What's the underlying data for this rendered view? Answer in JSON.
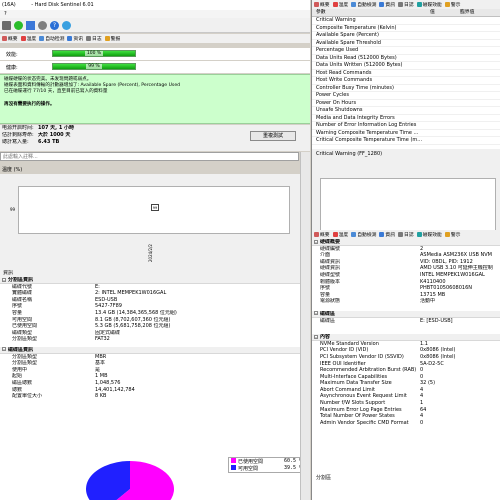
{
  "window": {
    "title_prefix": "(16A)",
    "title": "- Hard Disk Sentinel 6.01"
  },
  "menu": [
    "?"
  ],
  "toolbar_left": {
    "items": [
      "概要",
      "温度",
      "自动检测",
      "资讯",
      "日志",
      "警报"
    ]
  },
  "bars": [
    {
      "label": "效能:",
      "text": "100 %",
      "value": 100,
      "color": "#18c028"
    },
    {
      "label": "健康:",
      "text": "99 %",
      "value": 99,
      "color": "#18c028"
    }
  ],
  "status_box": {
    "lines": [
      "磁碟硬碟的状态完美。未发现問題或弱点。",
      "磁碟表面和資料傳輸的計數器增加了: Available Spare (Percent), Percentage Used",
      "已在磁碟運行 77/10 天，直至目前已寫入的資料量",
      "",
      "再沒有需要执行的操作。"
    ],
    "action_title": "再沒有需要执行的操作。"
  },
  "power": {
    "rows": [
      {
        "k": "电源开启时间:",
        "v": "107 天, 1 小時"
      },
      {
        "k": "估計剩餘寿命:",
        "v": "大於 1000 天"
      },
      {
        "k": "總計寫入量:",
        "v": "6.43 TB"
      }
    ],
    "repeat_button": "重複測試"
  },
  "comment_placeholder": "此處輸入註釋...",
  "temperature_label": "温度 (%)",
  "graph": {
    "y_mark": "99",
    "point_label": "99",
    "x_label": "2024/2/2"
  },
  "left_info": {
    "header": "資訊",
    "partition_section": "分割區資訊",
    "partition_rows": [
      {
        "k": "磁碟代號",
        "v": "E:"
      },
      {
        "k": "實體磁碟",
        "v": "2: INTEL MEMPEK1W016GAL"
      },
      {
        "k": "磁碟名稱",
        "v": "ESD-USB"
      },
      {
        "k": "序號",
        "v": "5427-7F89"
      },
      {
        "k": "容量",
        "v": "13.4 GB (14,384,365,568 位元組)"
      },
      {
        "k": "可用空間",
        "v": "8.1 GB (8,702,607,360 位元組)"
      },
      {
        "k": "已使用空間",
        "v": "5.3 GB (5,681,758,208 位元組)"
      },
      {
        "k": "磁碟類型",
        "v": "固定式磁碟"
      },
      {
        "k": "分割區類型",
        "v": "FAT32"
      }
    ],
    "geometry_section": "磁碟區資訊",
    "geometry_rows": [
      {
        "k": "分割區類型",
        "v": "MBR"
      },
      {
        "k": "分割區類型",
        "v": "基本"
      },
      {
        "k": "使用中",
        "v": "是"
      },
      {
        "k": "起始",
        "v": "1 MB"
      },
      {
        "k": "磁區總數",
        "v": "1,048,576"
      },
      {
        "k": "總數",
        "v": "14,401,142,784"
      },
      {
        "k": "配置單位大小",
        "v": "8 KB"
      }
    ]
  },
  "pie": {
    "used_label": "已使用空間",
    "used_pct": "60.5 %",
    "free_label": "可用空間",
    "free_pct": "39.5 %",
    "used_value": 60.5,
    "free_value": 39.5,
    "used_color": "#2020ff",
    "free_color": "#ff00ff"
  },
  "right_top": {
    "toolbar": [
      "概要",
      "温度",
      "自動檢測",
      "資訊",
      "日誌",
      "磁碟效能",
      "警示"
    ],
    "columns": [
      "參數",
      "值",
      "臨界值"
    ],
    "rows": [
      "Critical Warning",
      "Composite Temperature (Kelvin)",
      "Available Spare (Percent)",
      "Available Spare Threshold",
      "Percentage Used",
      "Data Units Read (512000 Bytes)",
      "Data Units Written (512000 Bytes)",
      "Host Read Commands",
      "Host Write Commands",
      "Controller Busy Time (minutes)",
      "Power Cycles",
      "Power On Hours",
      "Unsafe Shutdowns",
      "Media and Data Integrity Errors",
      "Number of Error Information Log Entries",
      "Warning Composite Temperature Time ...",
      "Critical Composite Temperature Time (m..."
    ],
    "chart_title": "Critical Warning (FF_1280)"
  },
  "right_bottom": {
    "toolbar": [
      "概要",
      "温度",
      "自動檢測",
      "資訊",
      "日誌",
      "磁碟效能",
      "警示"
    ],
    "section1": "硬碟概要",
    "rows1": [
      {
        "k": "硬碟編號",
        "v": "2"
      },
      {
        "k": "介面",
        "v": "ASMedia ASM236X USB NVM"
      },
      {
        "k": "磁碟資訊",
        "v": "VID: 0BDL, PID: 1912"
      },
      {
        "k": "硬碟資訊",
        "v": "AMD USB 3.10 可延伸主機控制"
      },
      {
        "k": "硬碟型號",
        "v": "INTEL MEMPEK1W016GAL"
      },
      {
        "k": "韌體版本",
        "v": "K4110400"
      },
      {
        "k": "序號",
        "v": "PHBT01050608016N"
      },
      {
        "k": "容量",
        "v": "13715 MB"
      },
      {
        "k": "電源狀態",
        "v": "活動中"
      }
    ],
    "section2": "磁碟區",
    "rows2": [
      {
        "k": "磁碟區",
        "v": "E: [ESD-USB]"
      }
    ],
    "section3": "內容",
    "rows3": [
      {
        "k": "NVMe Standard Version",
        "v": "1.1"
      },
      {
        "k": "PCI Vendor ID (VID)",
        "v": "0x8086 (Intel)"
      },
      {
        "k": "PCI Subsystem Vendor ID (SSVID)",
        "v": "0x8086 (Intel)"
      },
      {
        "k": "IEEE OUI Identifier",
        "v": "5A-D2-5C"
      },
      {
        "k": "Recommended Arbitration Burst (RAB)",
        "v": "0"
      },
      {
        "k": "Multi-Interface Capabilities",
        "v": "0"
      },
      {
        "k": "Maximum Data Transfer Size",
        "v": "32 (5)"
      },
      {
        "k": "Abort Command Limit",
        "v": "4"
      },
      {
        "k": "Asynchronous Event Request Limit",
        "v": "4"
      },
      {
        "k": "Number f/W Slots Support",
        "v": "1"
      },
      {
        "k": "Maximum Error Log Page Entries",
        "v": "64"
      },
      {
        "k": "Total Number Of Power States",
        "v": "4"
      },
      {
        "k": "Admin Vendor Specific CMD Format",
        "v": "0"
      }
    ],
    "footer": "分割區"
  }
}
